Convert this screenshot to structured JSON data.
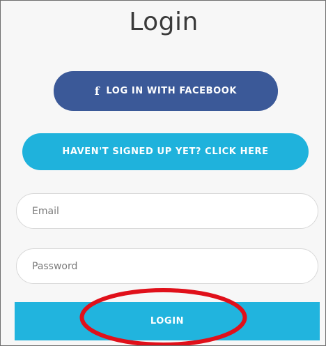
{
  "page": {
    "title": "Login"
  },
  "buttons": {
    "facebook": {
      "icon": "f",
      "label": "LOG IN WITH FACEBOOK",
      "color": "#3b5998"
    },
    "signup": {
      "label": "HAVEN'T SIGNED UP YET? CLICK HERE",
      "color": "#1fb2dc"
    },
    "login": {
      "label": "LOGIN",
      "color": "#21b4de"
    }
  },
  "form": {
    "email": {
      "placeholder": "Email",
      "value": ""
    },
    "password": {
      "placeholder": "Password",
      "value": ""
    }
  },
  "annotation": {
    "type": "red-ellipse-highlight",
    "color": "#e0101a",
    "target": "login-button"
  }
}
